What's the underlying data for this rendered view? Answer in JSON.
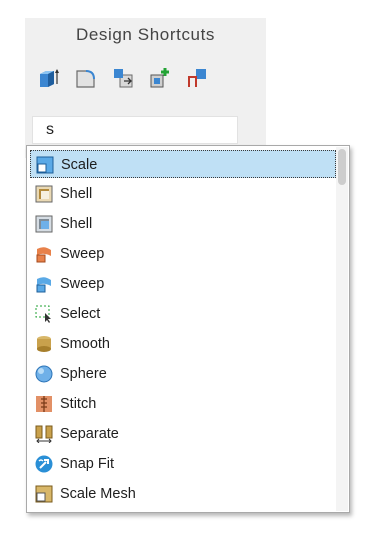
{
  "panel": {
    "title": "Design Shortcuts",
    "tools": [
      {
        "icon": "pull-icon"
      },
      {
        "icon": "round-icon"
      },
      {
        "icon": "move-icon"
      },
      {
        "icon": "combine-add-icon"
      },
      {
        "icon": "split-corner-icon"
      }
    ]
  },
  "search": {
    "value": "s"
  },
  "dropdown": {
    "items": [
      {
        "label": "Scale",
        "icon": "scale-icon",
        "selected": true
      },
      {
        "label": "Shell",
        "icon": "shell-icon",
        "selected": false
      },
      {
        "label": "Shell",
        "icon": "shell-grey-icon",
        "selected": false
      },
      {
        "label": "Sweep",
        "icon": "sweep-icon",
        "selected": false
      },
      {
        "label": "Sweep",
        "icon": "sweep-blue-icon",
        "selected": false
      },
      {
        "label": "Select",
        "icon": "select-icon",
        "selected": false
      },
      {
        "label": "Smooth",
        "icon": "smooth-icon",
        "selected": false
      },
      {
        "label": "Sphere",
        "icon": "sphere-icon",
        "selected": false
      },
      {
        "label": "Stitch",
        "icon": "stitch-icon",
        "selected": false
      },
      {
        "label": "Separate",
        "icon": "separate-icon",
        "selected": false
      },
      {
        "label": "Snap Fit",
        "icon": "snap-fit-icon",
        "selected": false
      },
      {
        "label": "Scale Mesh",
        "icon": "scale-mesh-icon",
        "selected": false
      }
    ]
  },
  "colors": {
    "selection": "#bfe0f5",
    "accent": "#2a8fd6"
  }
}
